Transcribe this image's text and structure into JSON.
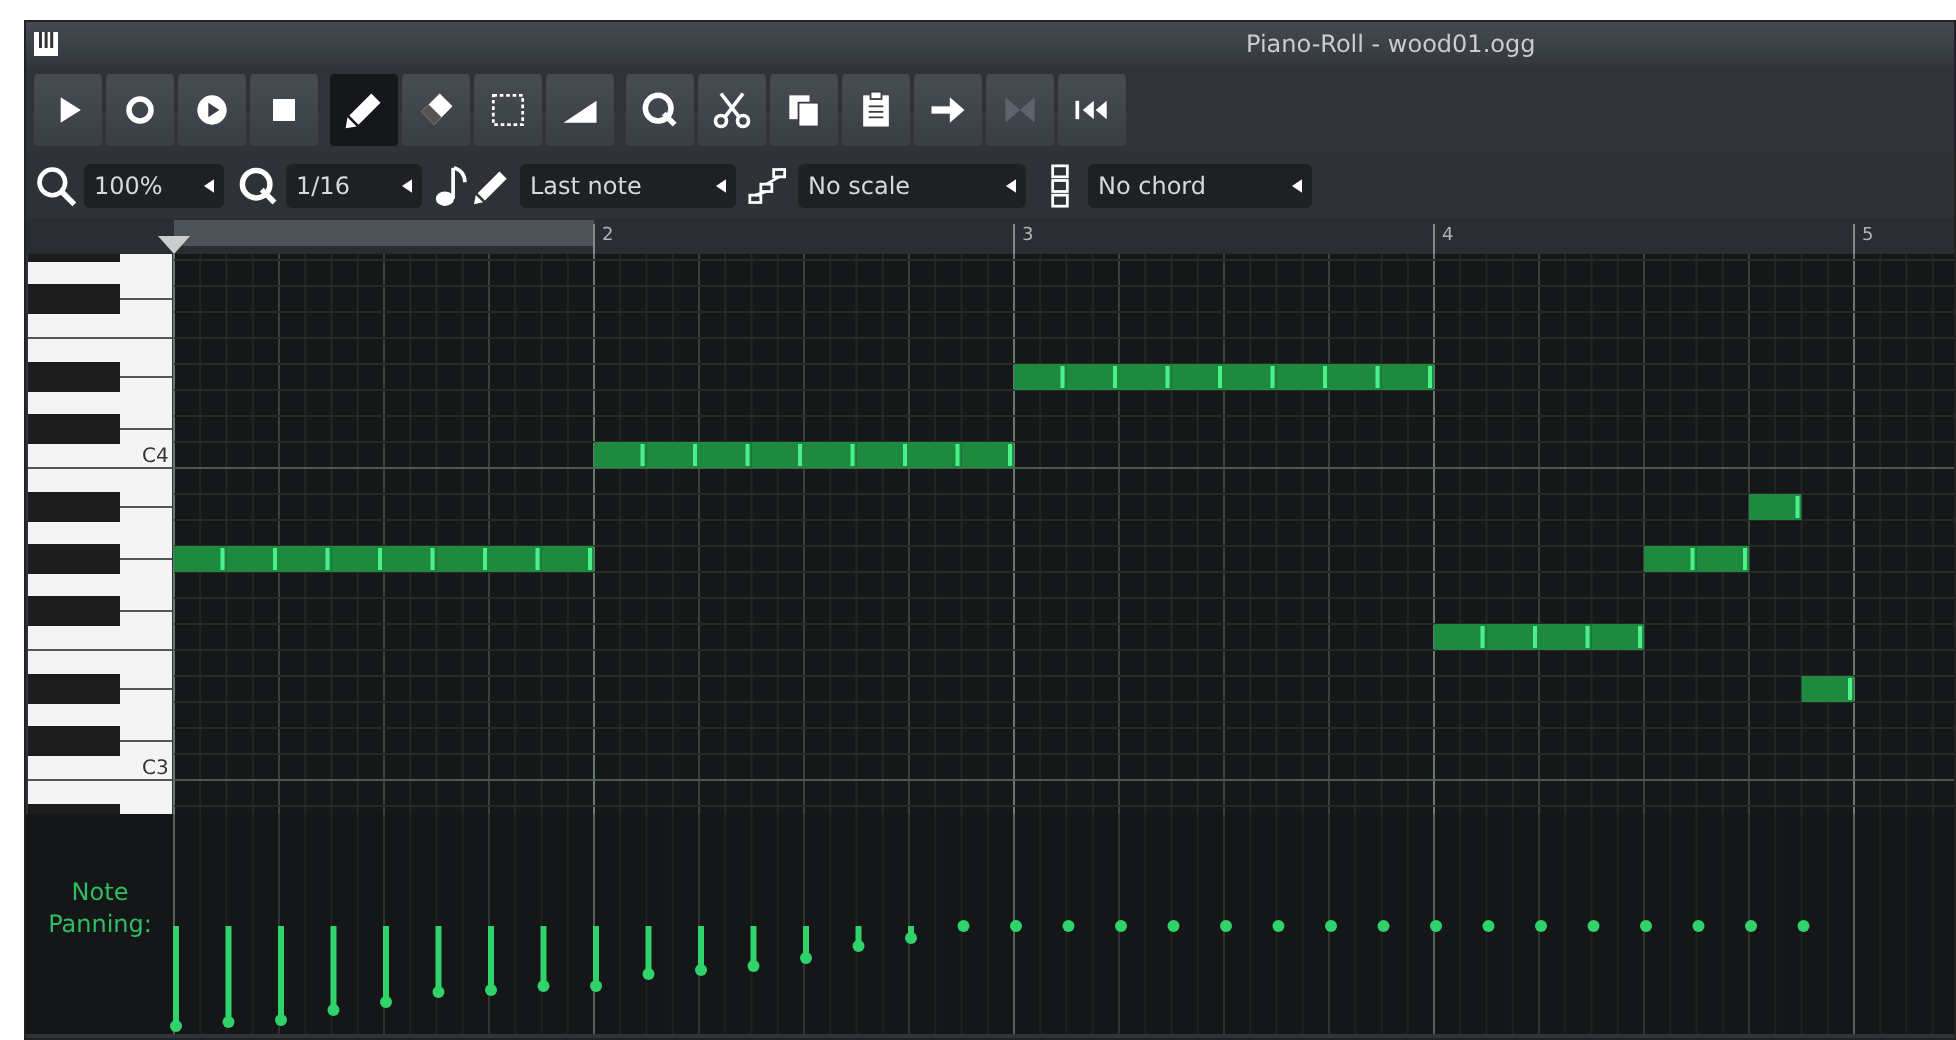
{
  "window": {
    "title": "Piano-Roll - wood01.ogg"
  },
  "transport": [
    {
      "kind": "play"
    },
    {
      "kind": "record"
    },
    {
      "kind": "record-play"
    },
    {
      "kind": "stop"
    }
  ],
  "edit_modes": [
    {
      "kind": "draw",
      "selected": true
    },
    {
      "kind": "erase",
      "selected": false
    },
    {
      "kind": "select",
      "selected": false
    },
    {
      "kind": "detune",
      "selected": false
    }
  ],
  "actions": [
    {
      "kind": "quantize",
      "disabled": false
    },
    {
      "kind": "cut",
      "disabled": false
    },
    {
      "kind": "copy",
      "disabled": false
    },
    {
      "kind": "paste",
      "disabled": false
    },
    {
      "kind": "arrow",
      "disabled": false
    },
    {
      "kind": "mirror",
      "disabled": true
    },
    {
      "kind": "rewind",
      "disabled": false
    }
  ],
  "controls": [
    {
      "kind": "zoom",
      "value": "100%"
    },
    {
      "kind": "quantize",
      "value": "1/16"
    },
    {
      "kind": "note-length",
      "value": "Last note"
    },
    {
      "kind": "scale",
      "value": "No scale"
    },
    {
      "kind": "chord",
      "value": "No chord"
    }
  ],
  "ruler": {
    "bars": [
      "2",
      "3",
      "4",
      "5"
    ]
  },
  "keyboard": {
    "labels": [
      {
        "kind": "c4",
        "text": "C4"
      },
      {
        "kind": "c3",
        "text": "C3"
      }
    ]
  },
  "panning": {
    "label": "Note Panning:"
  }
}
